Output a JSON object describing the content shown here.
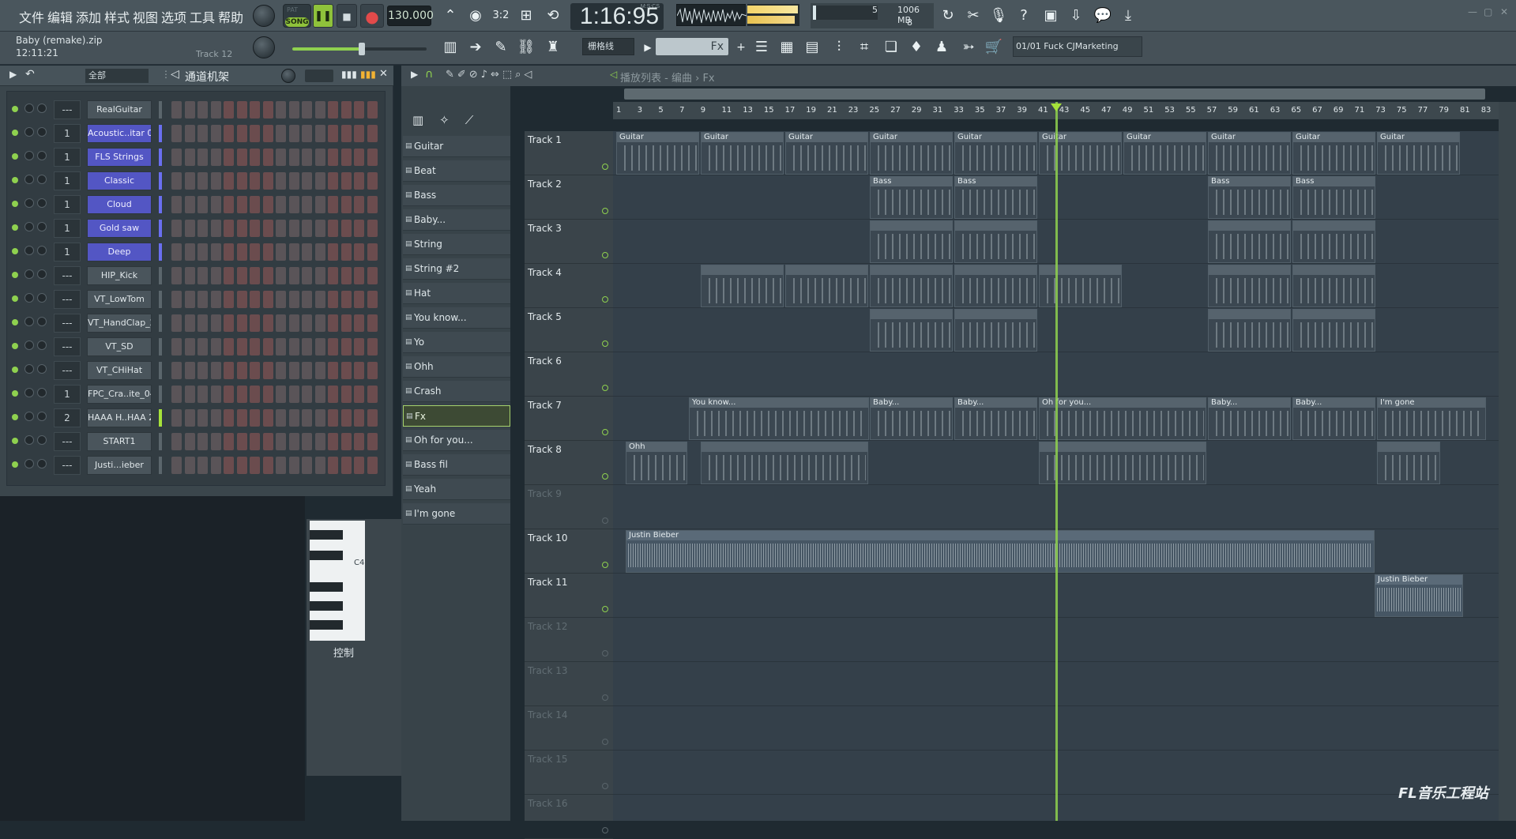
{
  "menu": [
    "文件",
    "编辑",
    "添加",
    "样式",
    "视图",
    "选项",
    "工具",
    "帮助"
  ],
  "transport": {
    "song_top": "PAT",
    "song_mode": "SONG",
    "tempo": "130.000"
  },
  "time_display": {
    "value": "1:16:95",
    "label": "M:S:CS"
  },
  "cpu": {
    "memory": "1006 MB",
    "voices": "8",
    "polyphony": "5"
  },
  "project": {
    "name": "Baby (remake).zip",
    "time": "12:11:21",
    "track": "Track 12"
  },
  "toolbar2": {
    "snap": "栅格线",
    "fx_field": "Fx",
    "hint_counter": "01/01",
    "hint_text": "Fuck CJMarketing"
  },
  "rack": {
    "filter": "全部",
    "title": "通道机架",
    "channels": [
      {
        "num": "---",
        "name": "RealGuitar"
      },
      {
        "num": "1",
        "name": "Acoustic..itar 01"
      },
      {
        "num": "1",
        "name": "FLS Strings"
      },
      {
        "num": "1",
        "name": "Classic"
      },
      {
        "num": "1",
        "name": "Cloud"
      },
      {
        "num": "1",
        "name": "Gold saw"
      },
      {
        "num": "1",
        "name": "Deep"
      },
      {
        "num": "---",
        "name": "HIP_Kick"
      },
      {
        "num": "---",
        "name": "VT_LowTom"
      },
      {
        "num": "---",
        "name": "VT_HandClap_2"
      },
      {
        "num": "---",
        "name": "VT_SD"
      },
      {
        "num": "---",
        "name": "VT_CHiHat"
      },
      {
        "num": "1",
        "name": "FPC_Cra..ite_04"
      },
      {
        "num": "2",
        "name": "HAAA H..HAA 2"
      },
      {
        "num": "---",
        "name": "START1"
      },
      {
        "num": "---",
        "name": "Justi...ieber"
      }
    ],
    "add_button": "+",
    "piano_key": "C4",
    "control_label": "控制"
  },
  "picker": {
    "patterns": [
      "Guitar",
      "Beat",
      "Bass",
      "Baby...",
      "String",
      "String #2",
      "Hat",
      "You know...",
      "Yo",
      "Ohh",
      "Crash",
      "Fx",
      "Oh for you...",
      "Bass fil",
      "Yeah",
      "I'm gone"
    ],
    "selected": "Fx"
  },
  "playlist": {
    "title": "播放列表 - 编曲",
    "crumb": "Fx",
    "ruler": [
      "1",
      "3",
      "5",
      "7",
      "9",
      "11",
      "13",
      "15",
      "17",
      "19",
      "21",
      "23",
      "25",
      "27",
      "29",
      "31",
      "33",
      "35",
      "37",
      "39",
      "41",
      "43",
      "45",
      "47",
      "49",
      "51",
      "53",
      "55",
      "57",
      "59",
      "61",
      "63",
      "65",
      "67",
      "69",
      "71",
      "73",
      "75",
      "77",
      "79",
      "81",
      "83"
    ],
    "tracks": [
      "Track 1",
      "Track 2",
      "Track 3",
      "Track 4",
      "Track 5",
      "Track 6",
      "Track 7",
      "Track 8",
      "Track 9",
      "Track 10",
      "Track 11",
      "Track 12",
      "Track 13",
      "Track 14",
      "Track 15",
      "Track 16"
    ],
    "clip_labels": {
      "guitar": "Guitar",
      "bass": "Bass",
      "you_know": "You know...",
      "baby": "Baby...",
      "oh_for_you": "Oh for you...",
      "im_gone": "I'm gone",
      "ohh": "Ohh",
      "justin": "Justin Bieber"
    }
  },
  "watermark": "FL音乐工程站"
}
